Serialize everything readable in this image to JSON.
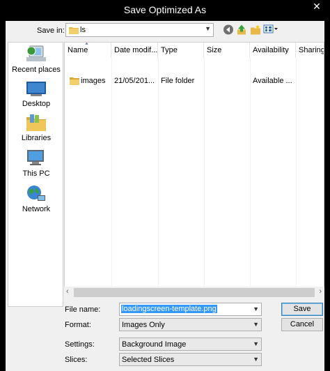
{
  "window": {
    "title": "Save Optimized As",
    "close_glyph": "✕"
  },
  "savein": {
    "label": "Save in:",
    "value": "ls"
  },
  "toolbar": {
    "icons": [
      "back-icon",
      "up-folder-icon",
      "new-folder-icon",
      "view-menu-icon"
    ]
  },
  "places": [
    {
      "label": "Recent places",
      "icon": "recent-places-icon"
    },
    {
      "label": "Desktop",
      "icon": "desktop-icon"
    },
    {
      "label": "Libraries",
      "icon": "libraries-icon"
    },
    {
      "label": "This PC",
      "icon": "this-pc-icon"
    },
    {
      "label": "Network",
      "icon": "network-icon"
    }
  ],
  "filelist": {
    "columns": [
      "Name",
      "Date modif...",
      "Type",
      "Size",
      "Availability",
      "Sharing"
    ],
    "rows": [
      {
        "name": "images",
        "date": "21/05/201...",
        "type": "File folder",
        "size": "",
        "availability": "Available ..."
      }
    ]
  },
  "form": {
    "filename_label": "File name:",
    "filename_value": "loadingscreen-template.png",
    "format_label": "Format:",
    "format_value": "Images Only",
    "settings_label": "Settings:",
    "settings_value": "Background Image",
    "slices_label": "Slices:",
    "slices_value": "Selected Slices"
  },
  "buttons": {
    "save": "Save",
    "cancel": "Cancel"
  },
  "colors": {
    "selection": "#3399ff",
    "folder": "#e8b84a",
    "title_bar": "#000000"
  }
}
